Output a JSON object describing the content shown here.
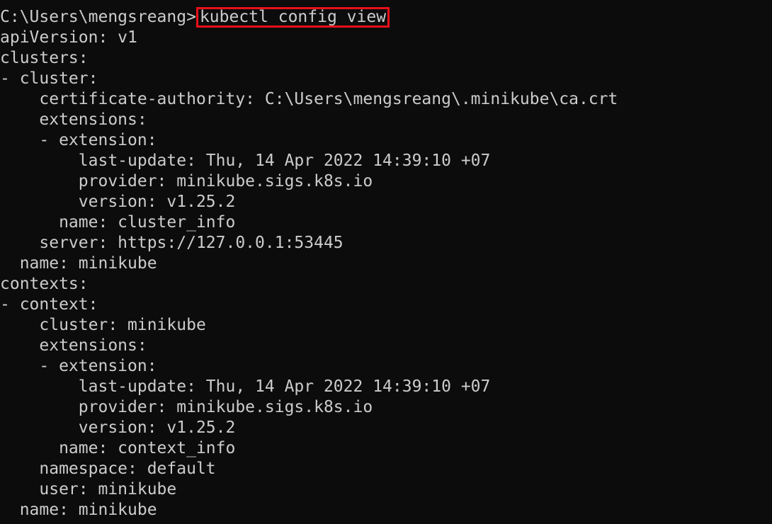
{
  "terminal": {
    "prompt": "C:\\Users\\mengsreang>",
    "command": "kubectl config view",
    "highlight_color": "#e8101a",
    "background_color": "#0c0c0c",
    "text_color": "#cccccc",
    "output": [
      "apiVersion: v1",
      "clusters:",
      "- cluster:",
      "    certificate-authority: C:\\Users\\mengsreang\\.minikube\\ca.crt",
      "    extensions:",
      "    - extension:",
      "        last-update: Thu, 14 Apr 2022 14:39:10 +07",
      "        provider: minikube.sigs.k8s.io",
      "        version: v1.25.2",
      "      name: cluster_info",
      "    server: https://127.0.0.1:53445",
      "  name: minikube",
      "contexts:",
      "- context:",
      "    cluster: minikube",
      "    extensions:",
      "    - extension:",
      "        last-update: Thu, 14 Apr 2022 14:39:10 +07",
      "        provider: minikube.sigs.k8s.io",
      "        version: v1.25.2",
      "      name: context_info",
      "    namespace: default",
      "    user: minikube",
      "  name: minikube"
    ]
  }
}
